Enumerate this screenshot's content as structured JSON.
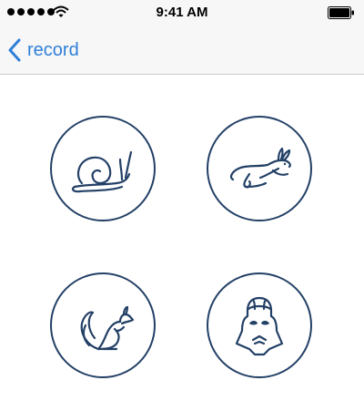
{
  "status_bar": {
    "time": "9:41 AM",
    "signal_icon": "signal-dots-icon",
    "wifi_icon": "wifi-icon",
    "battery_icon": "battery-icon"
  },
  "nav": {
    "back_label": "record",
    "back_icon": "chevron-left-icon",
    "accent_color": "#2f7fd8"
  },
  "modes": [
    {
      "icon": "snail-icon"
    },
    {
      "icon": "rabbit-icon"
    },
    {
      "icon": "squirrel-icon"
    },
    {
      "icon": "darth-vader-icon"
    }
  ],
  "colors": {
    "icon_stroke": "#234066",
    "bar_background": "#f7f7f8"
  }
}
